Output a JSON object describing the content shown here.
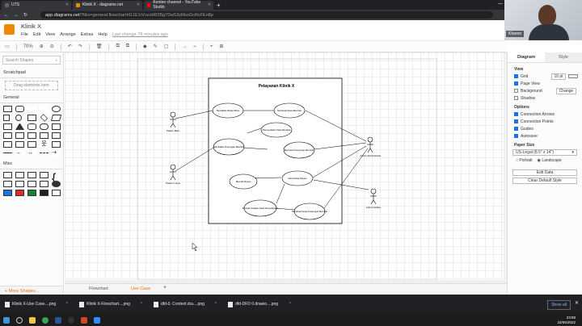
{
  "browser": {
    "tabs": [
      {
        "title": "UTS",
        "color": "#5f6368"
      },
      {
        "title": "Klinik X - diagrams.net",
        "color": "#f08705"
      },
      {
        "title": "Konten channel - YouTube Studio",
        "color": "#ff0000"
      }
    ],
    "url_host": "app.diagrams.net",
    "url_path": "/?libs=general;flowchart#G1E1rVxzxbR2Bg7Dw53zRkoGcRxFEn8p"
  },
  "webcam": {
    "label": "Kharon"
  },
  "app": {
    "title": "Klinik X",
    "menu": [
      "File",
      "Edit",
      "View",
      "Arrange",
      "Extras",
      "Help"
    ],
    "last_change": "Last change 78 minutes ago"
  },
  "toolbar": {
    "zoom": "70%"
  },
  "sidebar": {
    "search_placeholder": "Search Shapes",
    "scratchpad": "Scratchpad",
    "drag_hint": "Drag elements here",
    "general": "General",
    "misc": "Misc",
    "more_shapes": "+ More Shapes..."
  },
  "diagram": {
    "title": "Pelayanan Klinik X",
    "actors": [
      "Pasien Baru",
      "Pasien Lama",
      "Admin Administrasi",
      "Admin Dokter"
    ],
    "usecases": [
      "Mendaftar Pasien Baru",
      "Membuat Kartu Berobat",
      "Menunjukkan Kartu Berobat",
      "Mendaftar Kunjungan Berobat",
      "Membuat Kunjungan Berobat",
      "Memeriksa Pasien",
      "Menulis Resep",
      "Menulis Catatan Hasil Pemeriksaan",
      "Membuat Surat Kunjungan Berobat"
    ]
  },
  "page_tabs": [
    "Flowchart",
    "Use Case"
  ],
  "format_panel": {
    "tabs": [
      "Diagram",
      "Style"
    ],
    "view_heading": "View",
    "view_items": [
      {
        "label": "Grid",
        "checked": true
      },
      {
        "label": "Page View",
        "checked": true
      },
      {
        "label": "Background",
        "checked": false
      },
      {
        "label": "Shadow",
        "checked": false
      }
    ],
    "grid_size": "10 pt",
    "change_button": "Change",
    "options_heading": "Options",
    "options_items": [
      {
        "label": "Connection Arrows",
        "checked": true
      },
      {
        "label": "Connection Points",
        "checked": true
      },
      {
        "label": "Guides",
        "checked": true
      },
      {
        "label": "Autosave",
        "checked": true
      }
    ],
    "paper_heading": "Paper Size",
    "paper_value": "US-Legal (8.5\" x 14\")",
    "portrait": "Portrait",
    "landscape": "Landscape",
    "edit_data": "Edit Data",
    "clear_default_style": "Clear Default Style"
  },
  "downloads": [
    "Klinik X-Use Case....png",
    "Klinik X-Flowchart....png",
    "dfd-0. Context.dra....png",
    "dfd-DFD 0.drawio....png"
  ],
  "show_all": "Show all",
  "clock": {
    "time": "23:59",
    "date": "22/05/2022"
  }
}
